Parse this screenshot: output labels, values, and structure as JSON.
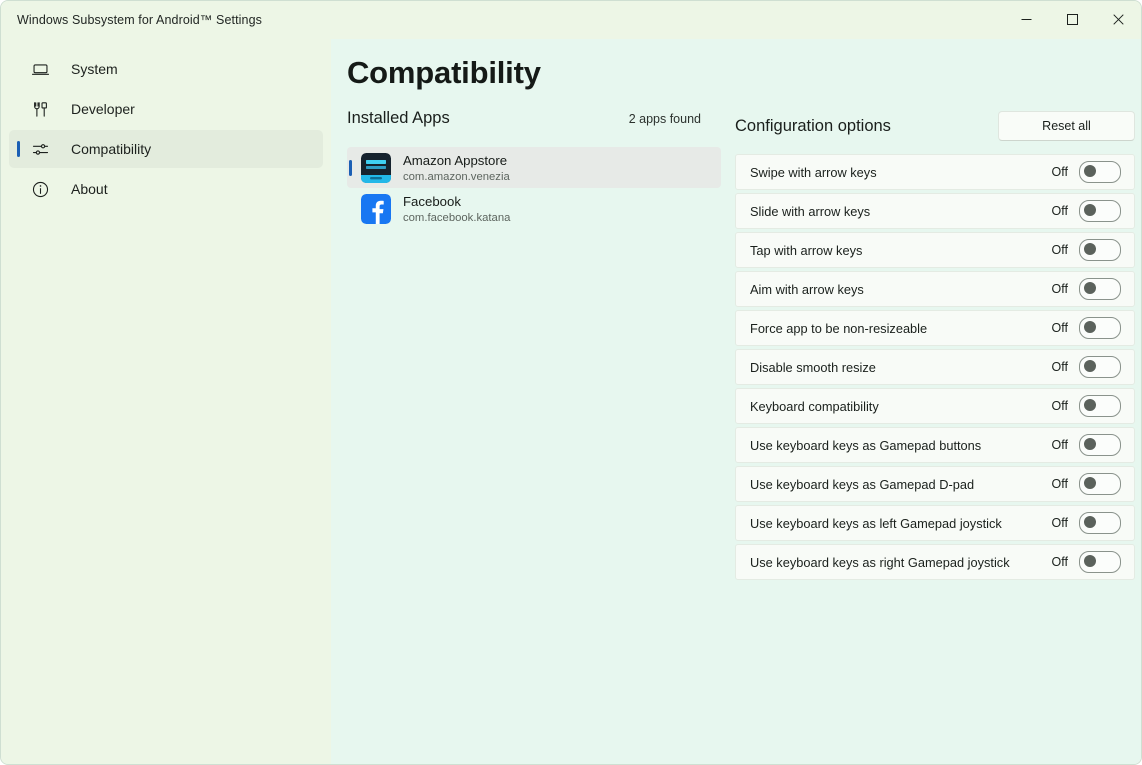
{
  "window": {
    "title": "Windows Subsystem for Android™ Settings",
    "controls": {
      "minimize_label": "Minimize",
      "maximize_label": "Maximize",
      "close_label": "Close"
    }
  },
  "sidebar": {
    "items": [
      {
        "label": "System",
        "icon": "laptop-icon",
        "selected": false
      },
      {
        "label": "Developer",
        "icon": "tools-icon",
        "selected": false
      },
      {
        "label": "Compatibility",
        "icon": "sliders-icon",
        "selected": true
      },
      {
        "label": "About",
        "icon": "info-circle-icon",
        "selected": false
      }
    ]
  },
  "page": {
    "title": "Compatibility"
  },
  "installed_apps": {
    "section_title": "Installed Apps",
    "count_label": "2 apps found",
    "apps": [
      {
        "name": "Amazon Appstore",
        "package": "com.amazon.venezia",
        "icon": "amazon-appstore-icon",
        "selected": true
      },
      {
        "name": "Facebook",
        "package": "com.facebook.katana",
        "icon": "facebook-icon",
        "selected": false
      }
    ]
  },
  "configuration": {
    "section_title": "Configuration options",
    "reset_label": "Reset all",
    "options": [
      {
        "label": "Swipe with arrow keys",
        "state": "Off",
        "on": false
      },
      {
        "label": "Slide with arrow keys",
        "state": "Off",
        "on": false
      },
      {
        "label": "Tap with arrow keys",
        "state": "Off",
        "on": false
      },
      {
        "label": "Aim with arrow keys",
        "state": "Off",
        "on": false
      },
      {
        "label": "Force app to be non-resizeable",
        "state": "Off",
        "on": false
      },
      {
        "label": "Disable smooth resize",
        "state": "Off",
        "on": false
      },
      {
        "label": "Keyboard compatibility",
        "state": "Off",
        "on": false
      },
      {
        "label": "Use keyboard keys as Gamepad buttons",
        "state": "Off",
        "on": false
      },
      {
        "label": "Use keyboard keys as Gamepad D-pad",
        "state": "Off",
        "on": false
      },
      {
        "label": "Use keyboard keys as left Gamepad joystick",
        "state": "Off",
        "on": false
      },
      {
        "label": "Use keyboard keys as right Gamepad joystick",
        "state": "Off",
        "on": false
      }
    ]
  },
  "colors": {
    "accent": "#1b5fb4",
    "sidebar_bg": "#edf6e6",
    "content_bg": "#e7f7ef",
    "card_bg": "#f8fbf7",
    "close_hover": "#c42b1c"
  }
}
